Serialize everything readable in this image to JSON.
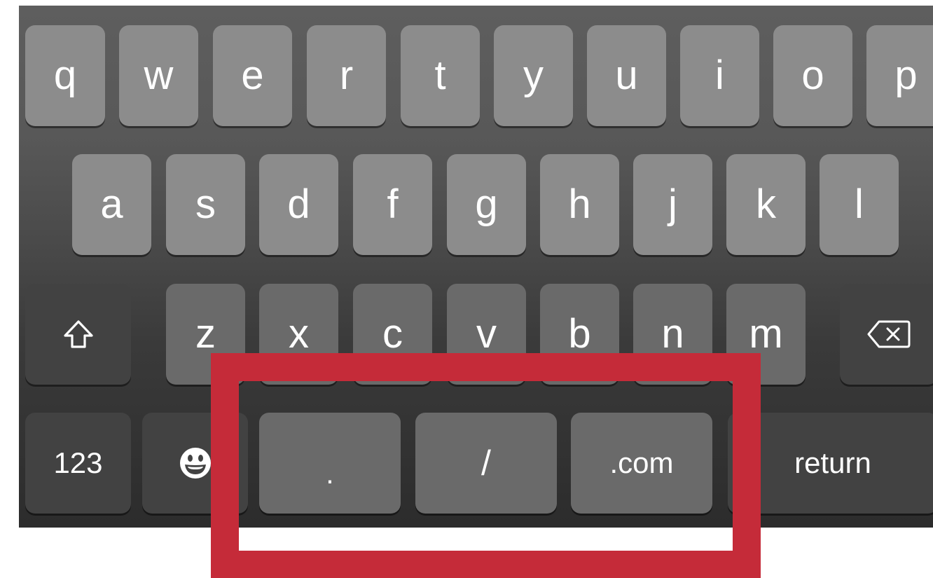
{
  "keyboard": {
    "row1": [
      "q",
      "w",
      "e",
      "r",
      "t",
      "y",
      "u",
      "i",
      "o",
      "p"
    ],
    "row2": [
      "a",
      "s",
      "d",
      "f",
      "g",
      "h",
      "j",
      "k",
      "l"
    ],
    "row3": [
      "z",
      "x",
      "c",
      "v",
      "b",
      "n",
      "m"
    ],
    "bottom": {
      "numbers_label": "123",
      "dot_label": ".",
      "slash_label": "/",
      "dotcom_label": ".com",
      "return_label": "return"
    },
    "icons": {
      "shift": "shift-arrow-icon",
      "delete": "backspace-icon",
      "emoji": "emoji-smiley-icon"
    }
  },
  "highlight": {
    "color": "#c52b39",
    "target": "bottom-row-url-keys"
  }
}
